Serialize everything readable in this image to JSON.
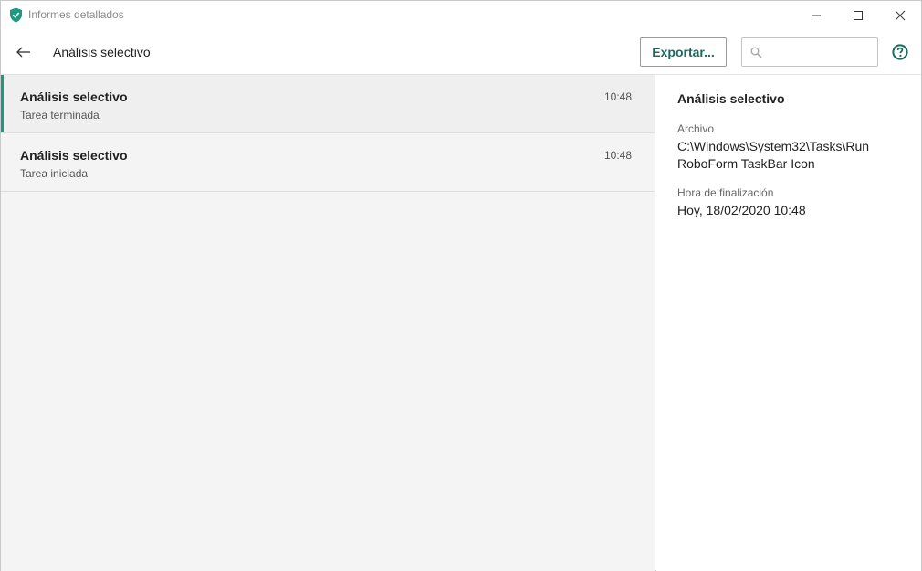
{
  "window": {
    "title": "Informes detallados",
    "accent_color": "#1c9a80"
  },
  "header": {
    "title": "Análisis selectivo",
    "export_label": "Exportar...",
    "search": {
      "value": "",
      "placeholder": ""
    }
  },
  "list": {
    "items": [
      {
        "title": "Análisis selectivo",
        "subtitle": "Tarea terminada",
        "time": "10:48",
        "selected": true
      },
      {
        "title": "Análisis selectivo",
        "subtitle": "Tarea iniciada",
        "time": "10:48",
        "selected": false
      }
    ]
  },
  "detail": {
    "title": "Análisis selectivo",
    "file_label": "Archivo",
    "file_value": "C:\\Windows\\System32\\Tasks\\Run RoboForm TaskBar Icon",
    "end_time_label": "Hora de finalización",
    "end_time_value": "Hoy, 18/02/2020 10:48"
  },
  "icons": {
    "app": "shield-check-icon",
    "back": "arrow-left-icon",
    "search": "magnifier-icon",
    "help": "question-circle-icon",
    "minimize": "minimize-icon",
    "maximize": "maximize-icon",
    "close": "close-icon"
  }
}
